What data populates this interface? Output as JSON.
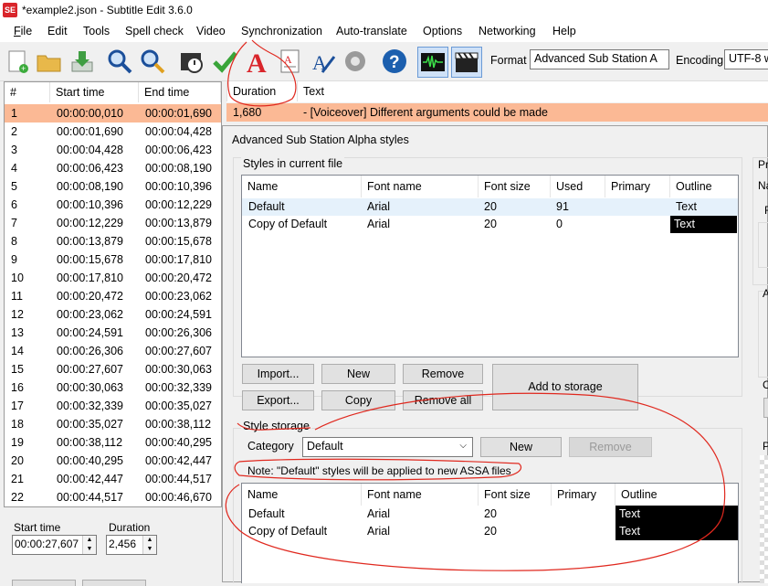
{
  "window": {
    "title": "*example2.json - Subtitle Edit 3.6.0",
    "icon_text": "SE"
  },
  "menu": [
    "File",
    "Edit",
    "Tools",
    "Spell check",
    "Video",
    "Synchronization",
    "Auto-translate",
    "Options",
    "Networking",
    "Help"
  ],
  "toolbar": {
    "icons": [
      "new-file-icon",
      "open-folder-icon",
      "download-icon",
      "find-icon",
      "replace-icon",
      "visual-sync-icon",
      "spell-check-icon",
      "text-style-icon",
      "text-file-icon",
      "edit-text-icon",
      "settings-icon",
      "help-icon",
      "waveform-icon",
      "video-icon"
    ],
    "format_label": "Format",
    "format_value": "Advanced Sub Station A",
    "encoding_label": "Encoding",
    "encoding_value": "UTF-8 w"
  },
  "grid": {
    "headers": [
      "#",
      "Start time",
      "End time",
      "Duration",
      "Text"
    ],
    "rows": [
      {
        "n": "1",
        "start": "00:00:00,010",
        "end": "00:00:01,690",
        "dur": "1,680",
        "text": "- [Voiceover] Different arguments could be made"
      },
      {
        "n": "2",
        "start": "00:00:01,690",
        "end": "00:00:04,428"
      },
      {
        "n": "3",
        "start": "00:00:04,428",
        "end": "00:00:06,423"
      },
      {
        "n": "4",
        "start": "00:00:06,423",
        "end": "00:00:08,190"
      },
      {
        "n": "5",
        "start": "00:00:08,190",
        "end": "00:00:10,396"
      },
      {
        "n": "6",
        "start": "00:00:10,396",
        "end": "00:00:12,229"
      },
      {
        "n": "7",
        "start": "00:00:12,229",
        "end": "00:00:13,879"
      },
      {
        "n": "8",
        "start": "00:00:13,879",
        "end": "00:00:15,678"
      },
      {
        "n": "9",
        "start": "00:00:15,678",
        "end": "00:00:17,810"
      },
      {
        "n": "10",
        "start": "00:00:17,810",
        "end": "00:00:20,472"
      },
      {
        "n": "11",
        "start": "00:00:20,472",
        "end": "00:00:23,062"
      },
      {
        "n": "12",
        "start": "00:00:23,062",
        "end": "00:00:24,591"
      },
      {
        "n": "13",
        "start": "00:00:24,591",
        "end": "00:00:26,306"
      },
      {
        "n": "14",
        "start": "00:00:26,306",
        "end": "00:00:27,607"
      },
      {
        "n": "15",
        "start": "00:00:27,607",
        "end": "00:00:30,063"
      },
      {
        "n": "16",
        "start": "00:00:30,063",
        "end": "00:00:32,339"
      },
      {
        "n": "17",
        "start": "00:00:32,339",
        "end": "00:00:35,027"
      },
      {
        "n": "18",
        "start": "00:00:35,027",
        "end": "00:00:38,112"
      },
      {
        "n": "19",
        "start": "00:00:38,112",
        "end": "00:00:40,295"
      },
      {
        "n": "20",
        "start": "00:00:40,295",
        "end": "00:00:42,447"
      },
      {
        "n": "21",
        "start": "00:00:42,447",
        "end": "00:00:44,517"
      },
      {
        "n": "22",
        "start": "00:00:44,517",
        "end": "00:00:46,670"
      }
    ]
  },
  "editor": {
    "start_label": "Start time",
    "start_value": "00:00:27,607",
    "duration_label": "Duration",
    "duration_value": "2,456"
  },
  "dialog": {
    "title": "Advanced Sub Station Alpha styles",
    "current": {
      "group_label": "Styles in current file",
      "headers": [
        "Name",
        "Font name",
        "Font size",
        "Used",
        "Primary",
        "Outline"
      ],
      "rows": [
        {
          "name": "Default",
          "font": "Arial",
          "size": "20",
          "used": "91",
          "outline": "Text"
        },
        {
          "name": "Copy of Default",
          "font": "Arial",
          "size": "20",
          "used": "0",
          "outline": "Text"
        }
      ]
    },
    "buttons": {
      "import": "Import...",
      "new": "New",
      "remove": "Remove",
      "export": "Export...",
      "copy": "Copy",
      "remove_all": "Remove all",
      "add_storage": "Add to storage"
    },
    "storage": {
      "group_label": "Style storage",
      "category_label": "Category",
      "category_value": "Default",
      "new": "New",
      "remove": "Remove",
      "note": "Note: \"Default\" styles will be applied to new ASSA files",
      "headers": [
        "Name",
        "Font name",
        "Font size",
        "Primary",
        "Outline"
      ],
      "rows": [
        {
          "name": "Default",
          "font": "Arial",
          "size": "20",
          "outline": "Text"
        },
        {
          "name": "Copy of Default",
          "font": "Arial",
          "size": "20",
          "outline": "Text"
        }
      ]
    },
    "right_labels": [
      "Pr",
      "Na",
      "F",
      "A",
      "C",
      "P"
    ]
  },
  "colors": {
    "selected_row": "#fbb995",
    "annotation": "#e0281e"
  }
}
